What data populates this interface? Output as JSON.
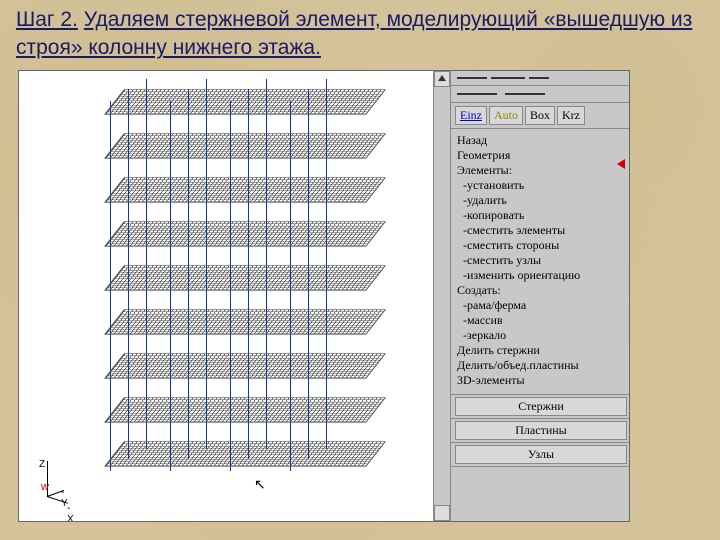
{
  "title": {
    "step": "Шаг 2.",
    "rest": "Удаляем стержневой элемент, моделирующий «вышедшую из строя» колонну нижнего этажа."
  },
  "toolbar": {
    "einz": "Einz",
    "auto": "Auto",
    "box": "Box",
    "krz": "Krz"
  },
  "menu": {
    "back": "Назад",
    "geometry": "Геометрия",
    "elements": "Элементы:",
    "set": "-установить",
    "delete": "-удалить",
    "copy": "-копировать",
    "moveEl": "-сместить элементы",
    "moveSides": "-сместить стороны",
    "moveNodes": "-сместить узлы",
    "changeOrient": "-изменить ориентацию",
    "create": "Создать:",
    "frame": "-рама/ферма",
    "array": "-массив",
    "mirror": "-зеркало",
    "divRods": "Делить стержни",
    "divPlates": "Делить/объед.пластины",
    "el3d": "3D-элементы"
  },
  "tabs": {
    "rods": "Стержни",
    "plates": "Пластины",
    "nodes": "Узлы"
  },
  "axes": {
    "z": "Z",
    "y": "-Y",
    "x": "-X",
    "w": "w"
  }
}
